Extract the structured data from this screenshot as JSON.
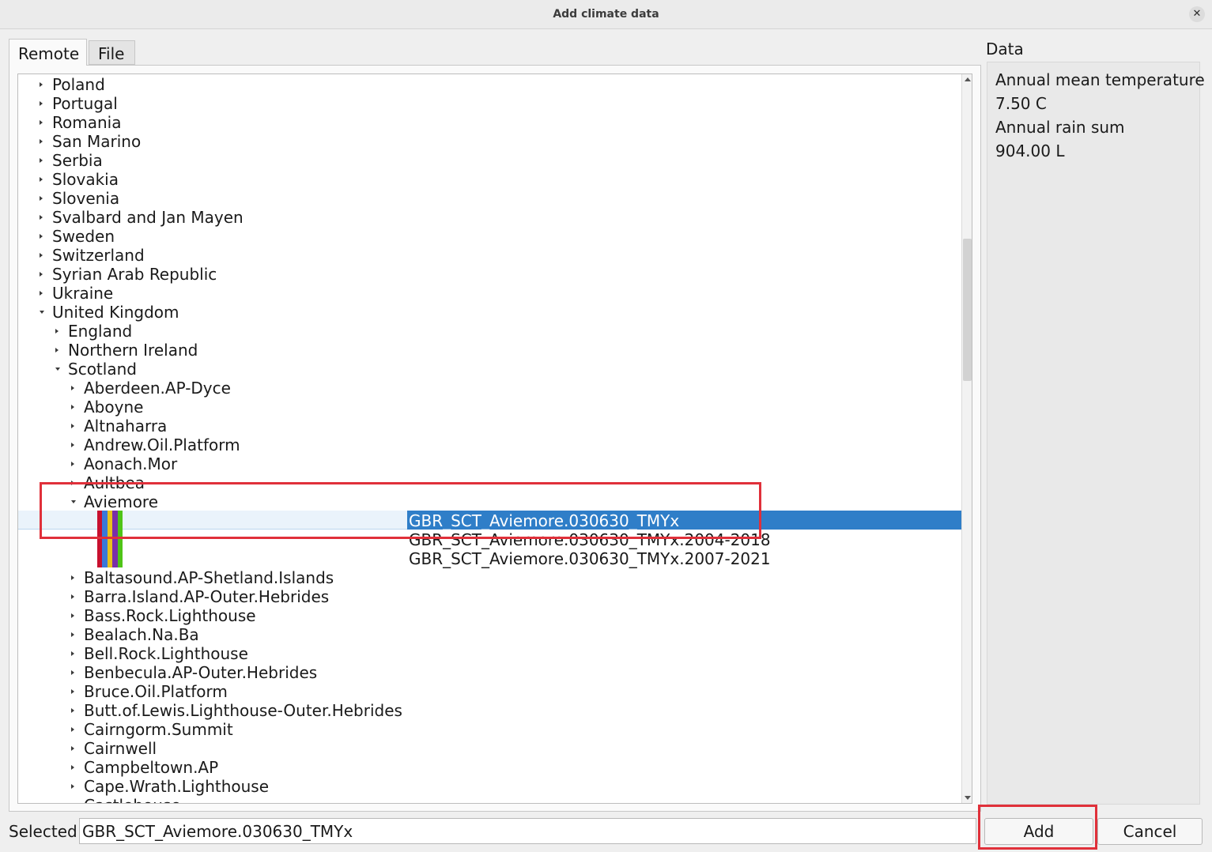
{
  "window": {
    "title": "Add climate data"
  },
  "tabs": [
    {
      "label": "Remote",
      "active": true
    },
    {
      "label": "File",
      "active": false
    }
  ],
  "tree": {
    "rows": [
      {
        "label": "Poland",
        "expanded": false,
        "depth": 0
      },
      {
        "label": "Portugal",
        "expanded": false,
        "depth": 0
      },
      {
        "label": "Romania",
        "expanded": false,
        "depth": 0
      },
      {
        "label": "San Marino",
        "expanded": false,
        "depth": 0
      },
      {
        "label": "Serbia",
        "expanded": false,
        "depth": 0
      },
      {
        "label": "Slovakia",
        "expanded": false,
        "depth": 0
      },
      {
        "label": "Slovenia",
        "expanded": false,
        "depth": 0
      },
      {
        "label": "Svalbard and Jan Mayen",
        "expanded": false,
        "depth": 0
      },
      {
        "label": "Sweden",
        "expanded": false,
        "depth": 0
      },
      {
        "label": "Switzerland",
        "expanded": false,
        "depth": 0
      },
      {
        "label": "Syrian Arab Republic",
        "expanded": false,
        "depth": 0
      },
      {
        "label": "Ukraine",
        "expanded": false,
        "depth": 0
      },
      {
        "label": "United Kingdom",
        "expanded": true,
        "depth": 0
      },
      {
        "label": "England",
        "expanded": false,
        "depth": 1
      },
      {
        "label": "Northern Ireland",
        "expanded": false,
        "depth": 1
      },
      {
        "label": "Scotland",
        "expanded": true,
        "depth": 1
      },
      {
        "label": "Aberdeen.AP-Dyce",
        "expanded": false,
        "depth": 2
      },
      {
        "label": "Aboyne",
        "expanded": false,
        "depth": 2
      },
      {
        "label": "Altnaharra",
        "expanded": false,
        "depth": 2
      },
      {
        "label": "Andrew.Oil.Platform",
        "expanded": false,
        "depth": 2
      },
      {
        "label": "Aonach.Mor",
        "expanded": false,
        "depth": 2
      },
      {
        "label": "Aultbea",
        "expanded": false,
        "depth": 2
      },
      {
        "label": "Aviemore",
        "expanded": true,
        "depth": 2
      }
    ],
    "files": [
      {
        "label": "GBR_SCT_Aviemore.030630_TMYx",
        "selected": true
      },
      {
        "label": "GBR_SCT_Aviemore.030630_TMYx.2004-2018",
        "selected": false
      },
      {
        "label": "GBR_SCT_Aviemore.030630_TMYx.2007-2021",
        "selected": false
      }
    ],
    "color_bars": [
      "#c8102e",
      "#3a78d8",
      "#e8c21c",
      "#7a2ea8",
      "#4fc417"
    ],
    "after_rows": [
      {
        "label": "Baltasound.AP-Shetland.Islands",
        "expanded": false,
        "depth": 2
      },
      {
        "label": "Barra.Island.AP-Outer.Hebrides",
        "expanded": false,
        "depth": 2
      },
      {
        "label": "Bass.Rock.Lighthouse",
        "expanded": false,
        "depth": 2
      },
      {
        "label": "Bealach.Na.Ba",
        "expanded": false,
        "depth": 2
      },
      {
        "label": "Bell.Rock.Lighthouse",
        "expanded": false,
        "depth": 2
      },
      {
        "label": "Benbecula.AP-Outer.Hebrides",
        "expanded": false,
        "depth": 2
      },
      {
        "label": "Bruce.Oil.Platform",
        "expanded": false,
        "depth": 2
      },
      {
        "label": "Butt.of.Lewis.Lighthouse-Outer.Hebrides",
        "expanded": false,
        "depth": 2
      },
      {
        "label": "Cairngorm.Summit",
        "expanded": false,
        "depth": 2
      },
      {
        "label": "Cairnwell",
        "expanded": false,
        "depth": 2
      },
      {
        "label": "Campbeltown.AP",
        "expanded": false,
        "depth": 2
      },
      {
        "label": "Cape.Wrath.Lighthouse",
        "expanded": false,
        "depth": 2
      },
      {
        "label": "Castlehouse",
        "expanded": false,
        "depth": 2
      }
    ]
  },
  "data_panel": {
    "title": "Data",
    "lines": [
      "Annual mean temperature",
      "7.50 C",
      "Annual rain sum",
      "904.00 L"
    ]
  },
  "footer": {
    "selected_label": "Selected",
    "selected_value": "GBR_SCT_Aviemore.030630_TMYx",
    "add_label": "Add",
    "cancel_label": "Cancel"
  },
  "colors": {
    "selection": "#2f7ec8",
    "annotation": "#e0303a"
  }
}
